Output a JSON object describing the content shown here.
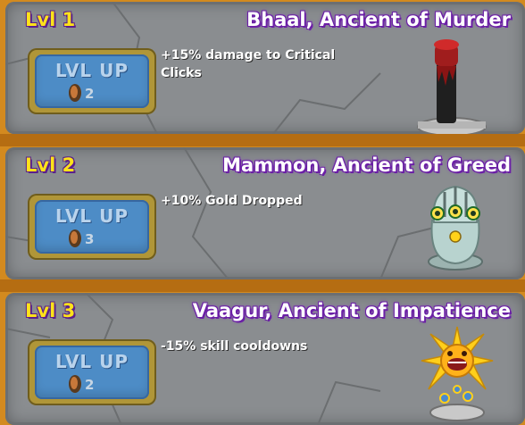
{
  "ancients": [
    {
      "level": "Lvl 1",
      "name": "Bhaal, Ancient of Murder",
      "description": "+15% damage to Critical Clicks",
      "button_label": "LVL UP",
      "cost": "2",
      "icon": "bhaal-pillar-icon"
    },
    {
      "level": "Lvl 2",
      "name": "Mammon, Ancient of Greed",
      "description": "+10% Gold Dropped",
      "button_label": "LVL UP",
      "cost": "3",
      "icon": "mammon-statue-icon"
    },
    {
      "level": "Lvl 3",
      "name": "Vaagur, Ancient of Impatience",
      "description": "-15% skill cooldowns",
      "button_label": "LVL UP",
      "cost": "2",
      "icon": "vaagur-sun-icon"
    }
  ],
  "colors": {
    "background": "#d38a1f",
    "panel": "#8a8d90",
    "level_text": "#ffe21a",
    "name_outline": "#6b1fa6",
    "button": "#4d8cc6",
    "button_frame": "#b09638"
  }
}
